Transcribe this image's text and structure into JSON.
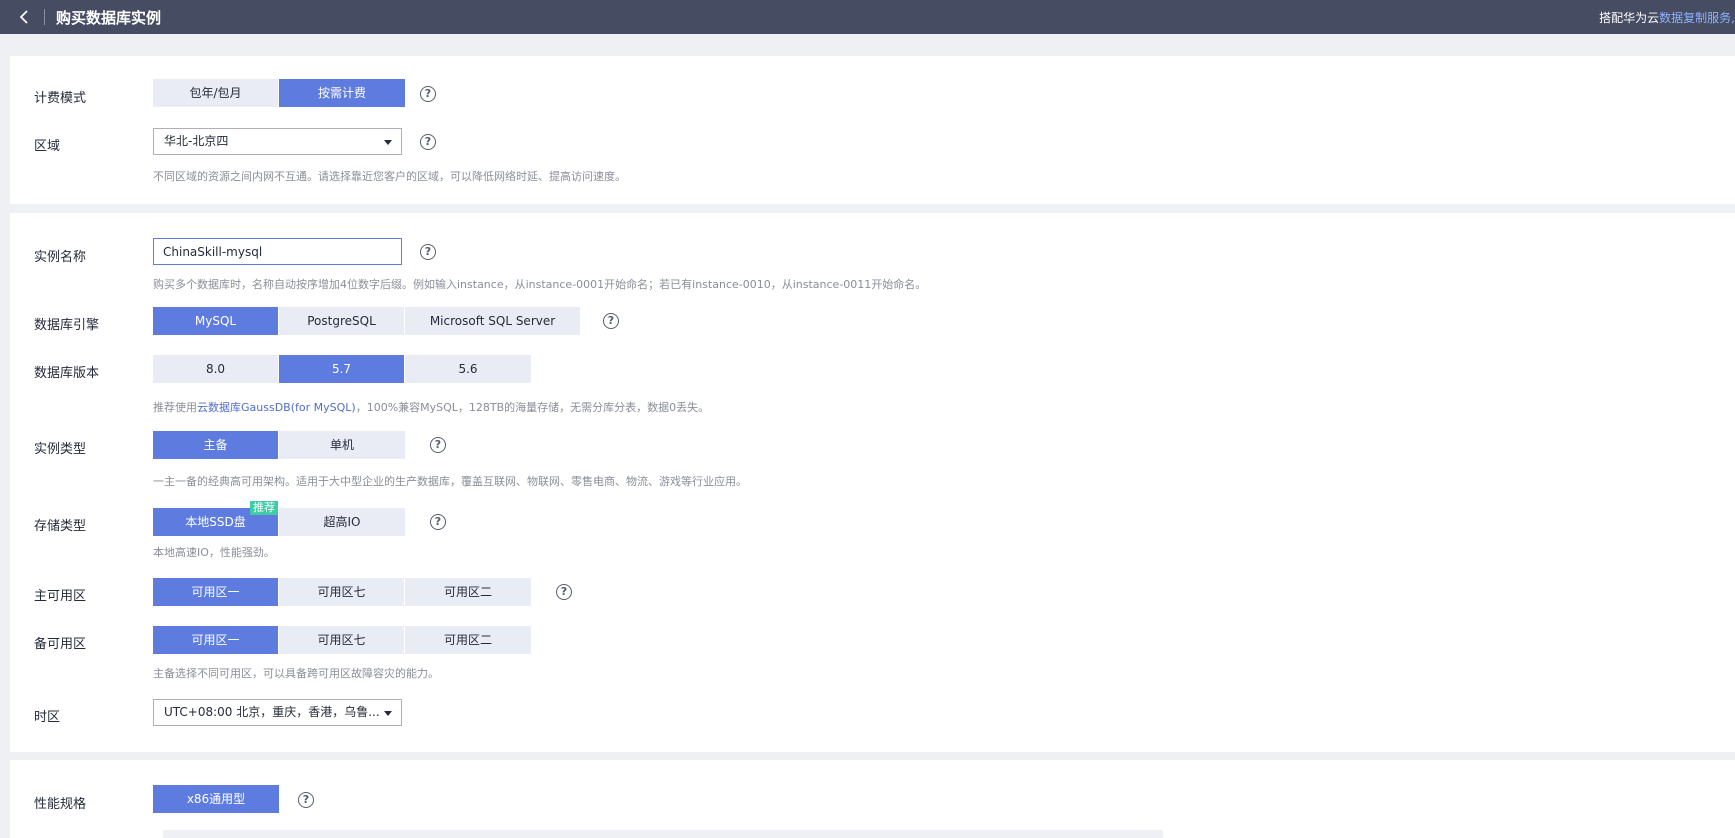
{
  "header": {
    "title": "购买数据库实例",
    "right_prefix": "搭配华为云",
    "right_link": "数据复制服务,"
  },
  "billing": {
    "label": "计费模式",
    "options": [
      "包年/包月",
      "按需计费"
    ],
    "selected": "按需计费"
  },
  "region": {
    "label": "区域",
    "value": "华北-北京四",
    "hint": "不同区域的资源之间内网不互通。请选择靠近您客户的区域，可以降低网络时延、提高访问速度。"
  },
  "instance_name": {
    "label": "实例名称",
    "value": "ChinaSkill-mysql",
    "hint": "购买多个数据库时，名称自动按序增加4位数字后缀。例如输入instance，从instance-0001开始命名；若已有instance-0010，从instance-0011开始命名。"
  },
  "engine": {
    "label": "数据库引擎",
    "options": [
      "MySQL",
      "PostgreSQL",
      "Microsoft SQL Server"
    ],
    "selected": "MySQL"
  },
  "version": {
    "label": "数据库版本",
    "options": [
      "8.0",
      "5.7",
      "5.6"
    ],
    "selected": "5.7",
    "hint_prefix": "推荐使用",
    "hint_link": "云数据库GaussDB(for MySQL)",
    "hint_suffix": "，100%兼容MySQL，128TB的海量存储，无需分库分表，数据0丢失。"
  },
  "instance_type": {
    "label": "实例类型",
    "options": [
      "主备",
      "单机"
    ],
    "selected": "主备",
    "hint": "一主一备的经典高可用架构。适用于大中型企业的生产数据库，覆盖互联网、物联网、零售电商、物流、游戏等行业应用。"
  },
  "storage": {
    "label": "存储类型",
    "options": [
      "本地SSD盘",
      "超高IO"
    ],
    "selected": "本地SSD盘",
    "badge": "推荐",
    "hint": "本地高速IO，性能强劲。"
  },
  "primary_az": {
    "label": "主可用区",
    "options": [
      "可用区一",
      "可用区七",
      "可用区二"
    ],
    "selected": "可用区一"
  },
  "standby_az": {
    "label": "备可用区",
    "options": [
      "可用区一",
      "可用区七",
      "可用区二"
    ],
    "selected": "可用区一",
    "hint": "主备选择不同可用区，可以具备跨可用区故障容灾的能力。"
  },
  "timezone": {
    "label": "时区",
    "value": "UTC+08:00 北京，重庆，香港，乌鲁..."
  },
  "spec": {
    "label": "性能规格",
    "options": [
      "x86通用型"
    ],
    "selected": "x86通用型"
  },
  "colors": {
    "header_bg": "#464d63",
    "accent": "#5e7ce0",
    "badge": "#3dcca6",
    "link": "#526ecc"
  }
}
